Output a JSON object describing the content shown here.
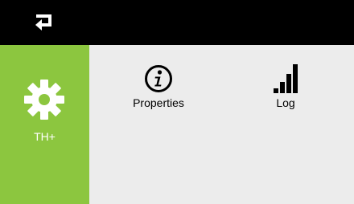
{
  "topbar": {
    "back_icon": "return-arrow-icon",
    "background": "#000000"
  },
  "sidebar": {
    "background": "#8cc63f",
    "items": [
      {
        "label": "TH+",
        "icon": "gear-icon"
      }
    ]
  },
  "main": {
    "background": "#ececec",
    "tiles": [
      {
        "label": "Properties",
        "icon": "info-icon"
      },
      {
        "label": "Log",
        "icon": "signal-bars-icon"
      }
    ]
  }
}
